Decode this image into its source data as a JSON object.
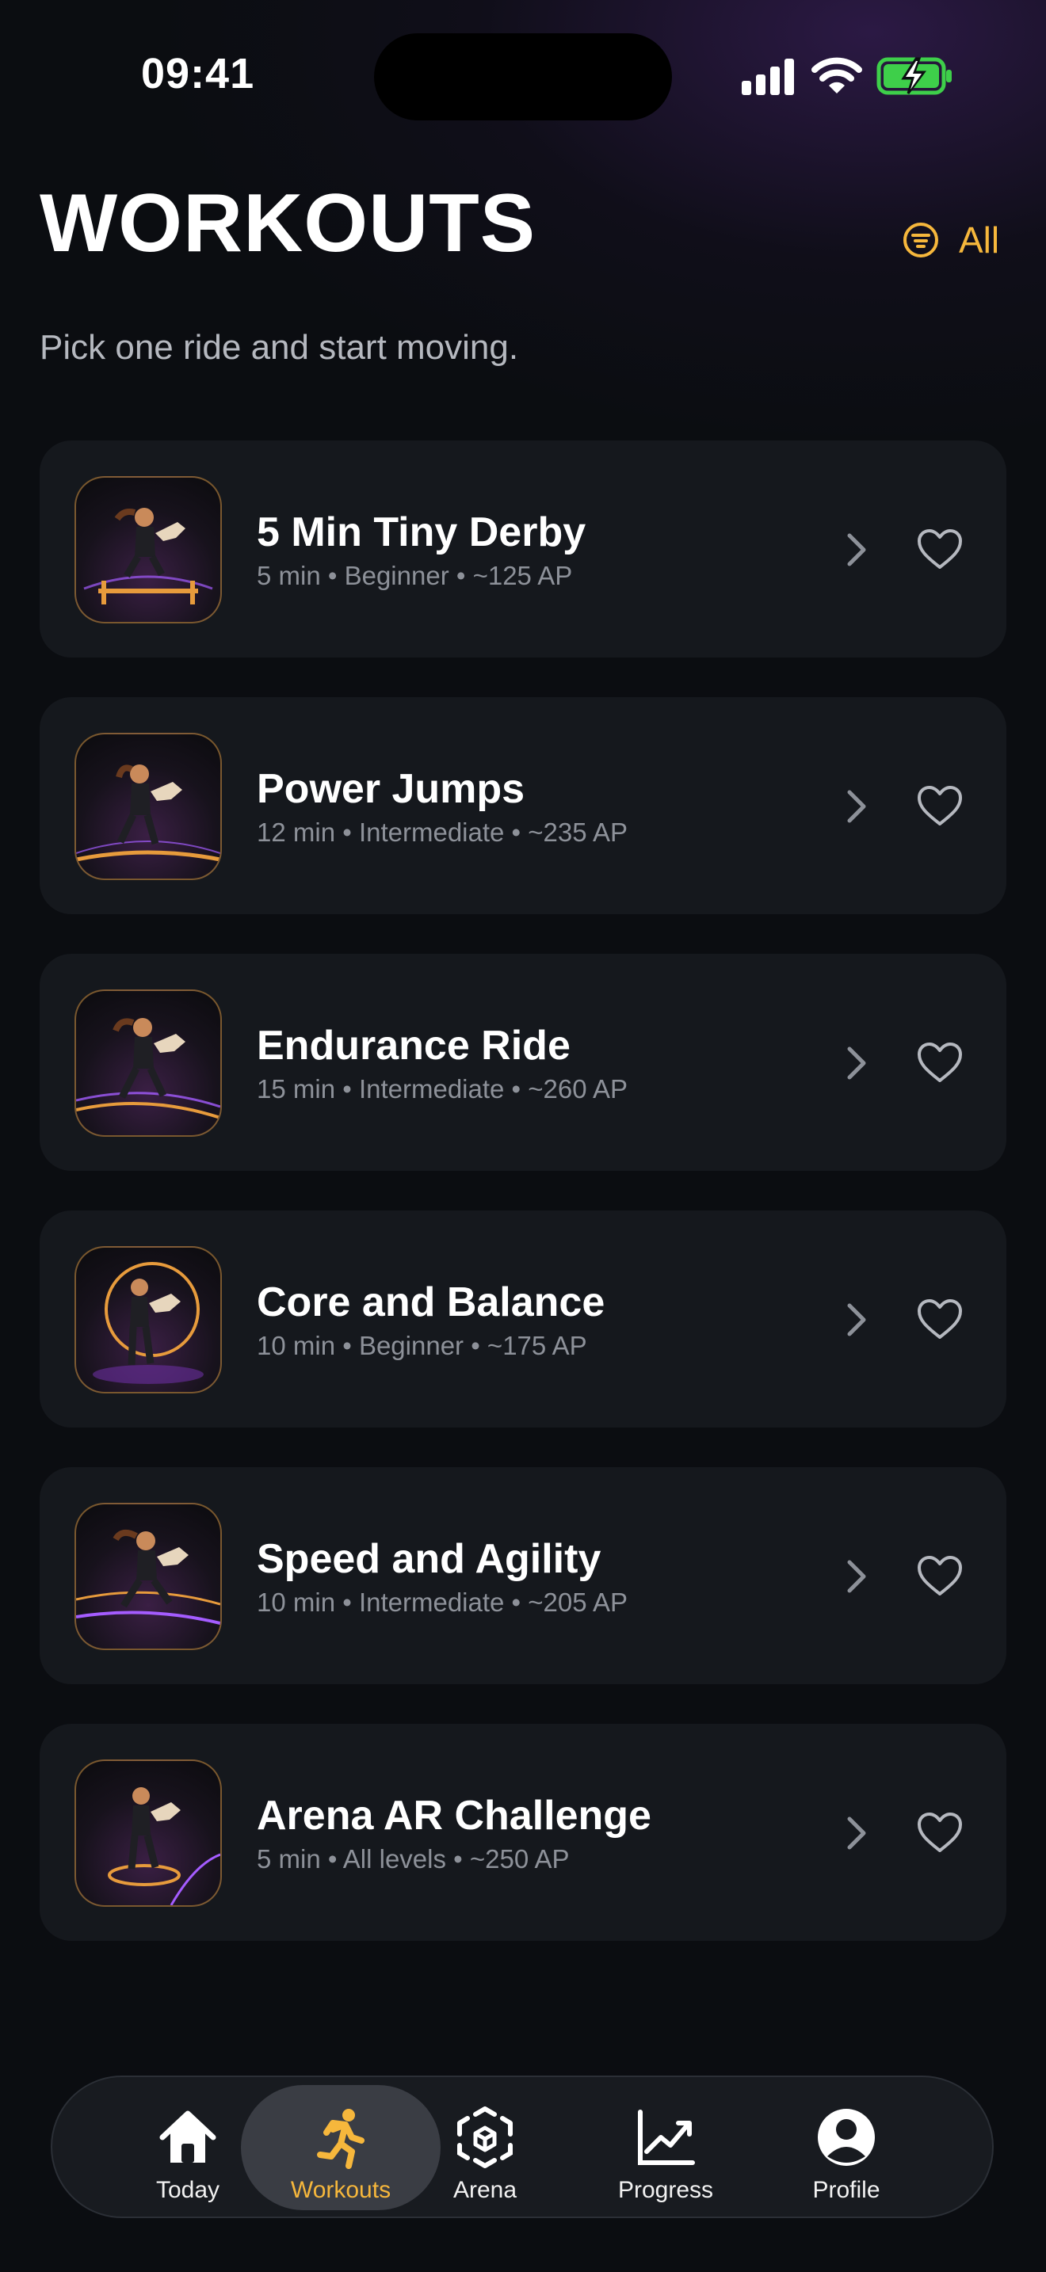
{
  "status_bar": {
    "time": "09:41"
  },
  "header": {
    "title": "WORKOUTS",
    "filter_label": "All",
    "subtitle": "Pick one ride and start moving."
  },
  "colors": {
    "accent": "#f6b73c",
    "card": "#15181d",
    "background": "#0b0d11",
    "battery": "#3ecf4a"
  },
  "workouts": [
    {
      "title": "5 Min Tiny Derby",
      "meta": "5 min • Beginner • ~125 AP",
      "thumbnail": "rider-over-jump-image"
    },
    {
      "title": "Power Jumps",
      "meta": "12 min • Intermediate • ~235 AP",
      "thumbnail": "rider-leap-image"
    },
    {
      "title": "Endurance Ride",
      "meta": "15 min • Intermediate • ~260 AP",
      "thumbnail": "rider-running-image"
    },
    {
      "title": "Core and Balance",
      "meta": "10 min • Beginner • ~175 AP",
      "thumbnail": "rider-ring-image"
    },
    {
      "title": "Speed and Agility",
      "meta": "10 min • Intermediate • ~205 AP",
      "thumbnail": "rider-speed-image"
    },
    {
      "title": "Arena AR Challenge",
      "meta": "5 min • All levels • ~250 AP",
      "thumbnail": "rider-arena-image"
    }
  ],
  "tab_bar": {
    "tabs": [
      {
        "label": "Today",
        "icon": "house-icon"
      },
      {
        "label": "Workouts",
        "icon": "running-figure-icon",
        "active": true
      },
      {
        "label": "Arena",
        "icon": "ar-cube-icon"
      },
      {
        "label": "Progress",
        "icon": "chart-trend-icon"
      },
      {
        "label": "Profile",
        "icon": "person-circle-icon"
      }
    ]
  }
}
